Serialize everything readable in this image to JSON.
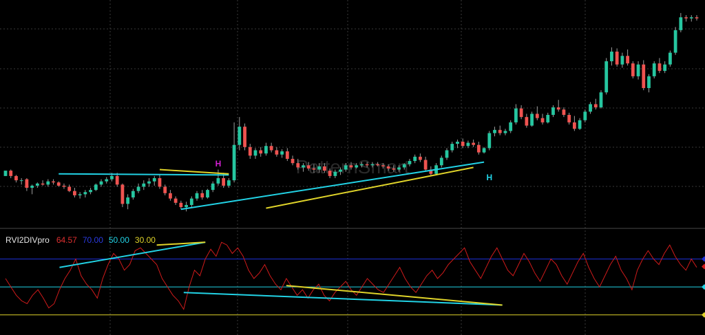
{
  "watermark": "PatternSmart",
  "colors": {
    "background": "#000000",
    "up": "#26c6a0",
    "down": "#ef5350",
    "wick": "#9e9e9e",
    "cyan": "#22d3e6",
    "yellow": "#e0d42a",
    "blue": "#1c2fd6",
    "magenta": "#d41fd4",
    "rvi_line": "#d01b1b",
    "grid": "#3a3a3a"
  },
  "indicator": {
    "name": "RVI2DIVpro",
    "values": [
      {
        "text": "64.57",
        "color": "#e03030"
      },
      {
        "text": "70.00",
        "color": "#2a3ae0"
      },
      {
        "text": "50.00",
        "color": "#22d3e6"
      },
      {
        "text": "30.00",
        "color": "#e0d42a"
      }
    ]
  },
  "chart_data": [
    {
      "type": "candlestick",
      "title": "",
      "candles": [
        [
          8.6,
          9.0,
          8.6,
          9.1
        ],
        [
          9.1,
          9.2,
          8.4,
          8.6
        ],
        [
          8.6,
          8.7,
          8.0,
          8.2
        ],
        [
          8.2,
          8.4,
          7.8,
          8.2
        ],
        [
          8.3,
          8.4,
          7.2,
          7.5
        ],
        [
          7.5,
          7.8,
          6.9,
          7.7
        ],
        [
          7.7,
          8.0,
          7.5,
          7.9
        ],
        [
          7.9,
          8.2,
          7.7,
          7.8
        ],
        [
          7.8,
          8.3,
          7.6,
          8.1
        ],
        [
          8.1,
          8.3,
          7.8,
          8.0
        ],
        [
          8.0,
          8.1,
          7.6,
          7.7
        ],
        [
          7.7,
          7.9,
          7.4,
          7.6
        ],
        [
          7.6,
          7.8,
          7.1,
          7.2
        ],
        [
          7.2,
          7.5,
          6.6,
          6.8
        ],
        [
          6.8,
          7.1,
          6.5,
          6.9
        ],
        [
          6.9,
          7.3,
          6.6,
          7.1
        ],
        [
          7.1,
          7.5,
          6.9,
          7.3
        ],
        [
          7.3,
          7.9,
          7.2,
          7.8
        ],
        [
          7.8,
          8.3,
          7.6,
          8.1
        ],
        [
          8.1,
          8.5,
          7.9,
          8.3
        ],
        [
          8.3,
          8.9,
          8.1,
          8.6
        ],
        [
          8.6,
          8.9,
          7.6,
          7.8
        ],
        [
          7.8,
          7.9,
          5.7,
          6.0
        ],
        [
          6.0,
          6.9,
          5.5,
          6.6
        ],
        [
          6.6,
          7.4,
          6.4,
          7.2
        ],
        [
          7.2,
          7.9,
          7.0,
          7.6
        ],
        [
          7.6,
          8.2,
          7.3,
          7.9
        ],
        [
          7.9,
          8.4,
          7.6,
          8.1
        ],
        [
          8.1,
          8.6,
          7.7,
          8.4
        ],
        [
          8.4,
          8.7,
          7.4,
          7.6
        ],
        [
          7.6,
          7.8,
          6.8,
          7.0
        ],
        [
          7.0,
          7.3,
          6.3,
          6.5
        ],
        [
          6.5,
          6.7,
          5.9,
          6.1
        ],
        [
          6.1,
          6.3,
          5.5,
          5.7
        ],
        [
          5.7,
          6.2,
          5.3,
          5.9
        ],
        [
          5.9,
          6.7,
          5.7,
          6.5
        ],
        [
          6.5,
          7.2,
          6.3,
          7.0
        ],
        [
          7.0,
          7.3,
          6.4,
          6.6
        ],
        [
          6.6,
          7.4,
          6.5,
          7.3
        ],
        [
          7.3,
          8.1,
          7.1,
          7.9
        ],
        [
          7.9,
          9.2,
          7.7,
          8.4
        ],
        [
          8.4,
          8.9,
          7.5,
          7.7
        ],
        [
          7.7,
          8.4,
          7.5,
          8.2
        ],
        [
          8.2,
          13.6,
          8.0,
          11.5
        ],
        [
          11.5,
          14.1,
          11.0,
          13.2
        ],
        [
          13.2,
          13.5,
          11.0,
          11.3
        ],
        [
          11.3,
          11.6,
          10.2,
          10.5
        ],
        [
          10.5,
          11.2,
          10.2,
          11.0
        ],
        [
          11.0,
          11.3,
          10.4,
          10.7
        ],
        [
          10.7,
          11.7,
          10.5,
          11.4
        ],
        [
          11.4,
          11.7,
          10.8,
          11.0
        ],
        [
          11.0,
          11.3,
          10.4,
          10.6
        ],
        [
          10.6,
          11.1,
          10.3,
          10.9
        ],
        [
          10.9,
          11.2,
          10.0,
          10.2
        ],
        [
          10.2,
          10.5,
          9.6,
          9.8
        ],
        [
          9.8,
          10.2,
          9.2,
          9.4
        ],
        [
          9.4,
          9.8,
          9.0,
          9.6
        ],
        [
          9.6,
          9.9,
          9.1,
          9.3
        ],
        [
          9.3,
          9.7,
          8.9,
          9.2
        ],
        [
          9.2,
          9.8,
          8.9,
          9.5
        ],
        [
          9.5,
          9.8,
          8.9,
          9.1
        ],
        [
          9.1,
          9.3,
          8.4,
          8.6
        ],
        [
          8.6,
          9.2,
          8.4,
          9.0
        ],
        [
          9.0,
          9.4,
          8.7,
          9.2
        ],
        [
          9.2,
          9.8,
          9.0,
          9.6
        ],
        [
          9.6,
          9.9,
          9.2,
          9.4
        ],
        [
          9.4,
          9.8,
          9.3,
          9.6
        ],
        [
          9.6,
          9.9,
          9.4,
          9.7
        ],
        [
          9.7,
          9.9,
          9.4,
          9.6
        ],
        [
          9.6,
          9.9,
          9.4,
          9.7
        ],
        [
          9.7,
          9.9,
          9.5,
          9.6
        ],
        [
          9.6,
          9.8,
          9.3,
          9.5
        ],
        [
          9.5,
          9.7,
          9.1,
          9.3
        ],
        [
          9.3,
          9.6,
          9.0,
          9.2
        ],
        [
          9.2,
          9.6,
          9.0,
          9.4
        ],
        [
          9.4,
          9.8,
          9.2,
          9.7
        ],
        [
          9.7,
          10.2,
          9.5,
          10.0
        ],
        [
          10.0,
          10.6,
          9.8,
          10.4
        ],
        [
          10.4,
          10.7,
          9.9,
          10.1
        ],
        [
          10.1,
          10.4,
          9.0,
          9.2
        ],
        [
          9.2,
          9.5,
          8.6,
          8.8
        ],
        [
          8.8,
          9.8,
          8.7,
          9.6
        ],
        [
          9.6,
          10.5,
          9.4,
          10.3
        ],
        [
          10.3,
          11.2,
          10.1,
          11.0
        ],
        [
          11.0,
          11.8,
          10.8,
          11.6
        ],
        [
          11.6,
          12.0,
          11.2,
          11.8
        ],
        [
          11.8,
          12.1,
          11.2,
          11.4
        ],
        [
          11.4,
          11.9,
          11.2,
          11.7
        ],
        [
          11.7,
          12.0,
          11.3,
          11.5
        ],
        [
          11.5,
          11.8,
          10.6,
          10.8
        ],
        [
          10.8,
          11.3,
          10.7,
          11.2
        ],
        [
          11.2,
          12.8,
          11.0,
          12.6
        ],
        [
          12.6,
          13.2,
          12.3,
          12.9
        ],
        [
          12.9,
          13.3,
          12.4,
          12.6
        ],
        [
          12.6,
          13.0,
          12.4,
          12.8
        ],
        [
          12.8,
          13.8,
          12.6,
          13.6
        ],
        [
          13.6,
          15.3,
          13.4,
          14.9
        ],
        [
          14.9,
          15.2,
          13.9,
          14.1
        ],
        [
          14.1,
          14.4,
          13.1,
          13.3
        ],
        [
          13.3,
          14.6,
          13.2,
          14.4
        ],
        [
          14.4,
          15.1,
          13.8,
          14.0
        ],
        [
          14.0,
          14.4,
          13.4,
          13.6
        ],
        [
          13.6,
          14.5,
          13.5,
          14.3
        ],
        [
          14.3,
          15.2,
          14.1,
          15.0
        ],
        [
          15.0,
          15.7,
          14.6,
          14.8
        ],
        [
          14.8,
          15.0,
          14.1,
          14.3
        ],
        [
          14.3,
          14.5,
          13.4,
          13.6
        ],
        [
          13.6,
          14.2,
          12.8,
          13.0
        ],
        [
          13.0,
          14.0,
          12.9,
          13.8
        ],
        [
          13.8,
          14.8,
          13.6,
          14.6
        ],
        [
          14.6,
          15.5,
          14.4,
          15.3
        ],
        [
          15.3,
          15.8,
          14.8,
          15.0
        ],
        [
          15.0,
          16.6,
          14.9,
          16.4
        ],
        [
          16.4,
          19.6,
          16.2,
          19.3
        ],
        [
          19.3,
          20.6,
          18.9,
          20.2
        ],
        [
          20.2,
          20.5,
          18.8,
          19.0
        ],
        [
          19.0,
          20.1,
          18.7,
          19.8
        ],
        [
          19.8,
          20.4,
          18.9,
          19.1
        ],
        [
          19.1,
          19.3,
          17.7,
          17.9
        ],
        [
          17.9,
          19.3,
          17.6,
          19.0
        ],
        [
          19.0,
          19.4,
          16.6,
          16.8
        ],
        [
          16.8,
          18.1,
          16.4,
          17.9
        ],
        [
          17.9,
          19.3,
          17.7,
          19.1
        ],
        [
          19.1,
          19.6,
          18.2,
          18.4
        ],
        [
          18.4,
          19.3,
          18.2,
          19.0
        ],
        [
          19.0,
          20.3,
          18.8,
          20.1
        ],
        [
          20.1,
          22.5,
          19.9,
          22.2
        ],
        [
          22.2,
          23.8,
          22.0,
          23.4
        ],
        [
          23.4,
          23.6,
          23.0,
          23.3
        ],
        [
          23.3,
          23.6,
          23.0,
          23.4
        ],
        [
          23.4,
          23.6,
          23.1,
          23.3
        ]
      ],
      "rvi": [
        56,
        50,
        44,
        40,
        38,
        44,
        48,
        42,
        35,
        38,
        48,
        56,
        62,
        70,
        58,
        52,
        48,
        42,
        56,
        66,
        74,
        70,
        62,
        66,
        76,
        78,
        74,
        70,
        66,
        56,
        50,
        44,
        40,
        34,
        50,
        62,
        58,
        70,
        77,
        72,
        82,
        80,
        74,
        78,
        72,
        62,
        56,
        60,
        66,
        58,
        52,
        48,
        56,
        50,
        44,
        48,
        42,
        48,
        52,
        44,
        40,
        46,
        50,
        54,
        48,
        44,
        50,
        56,
        52,
        48,
        46,
        52,
        58,
        64,
        56,
        50,
        46,
        52,
        58,
        62,
        56,
        60,
        66,
        70,
        74,
        78,
        68,
        62,
        56,
        64,
        72,
        78,
        70,
        62,
        58,
        66,
        74,
        68,
        60,
        54,
        62,
        70,
        66,
        58,
        52,
        60,
        68,
        74,
        64,
        56,
        50,
        58,
        66,
        72,
        62,
        56,
        48,
        62,
        70,
        76,
        70,
        66,
        74,
        80,
        72,
        66,
        62,
        70,
        64
      ]
    }
  ]
}
